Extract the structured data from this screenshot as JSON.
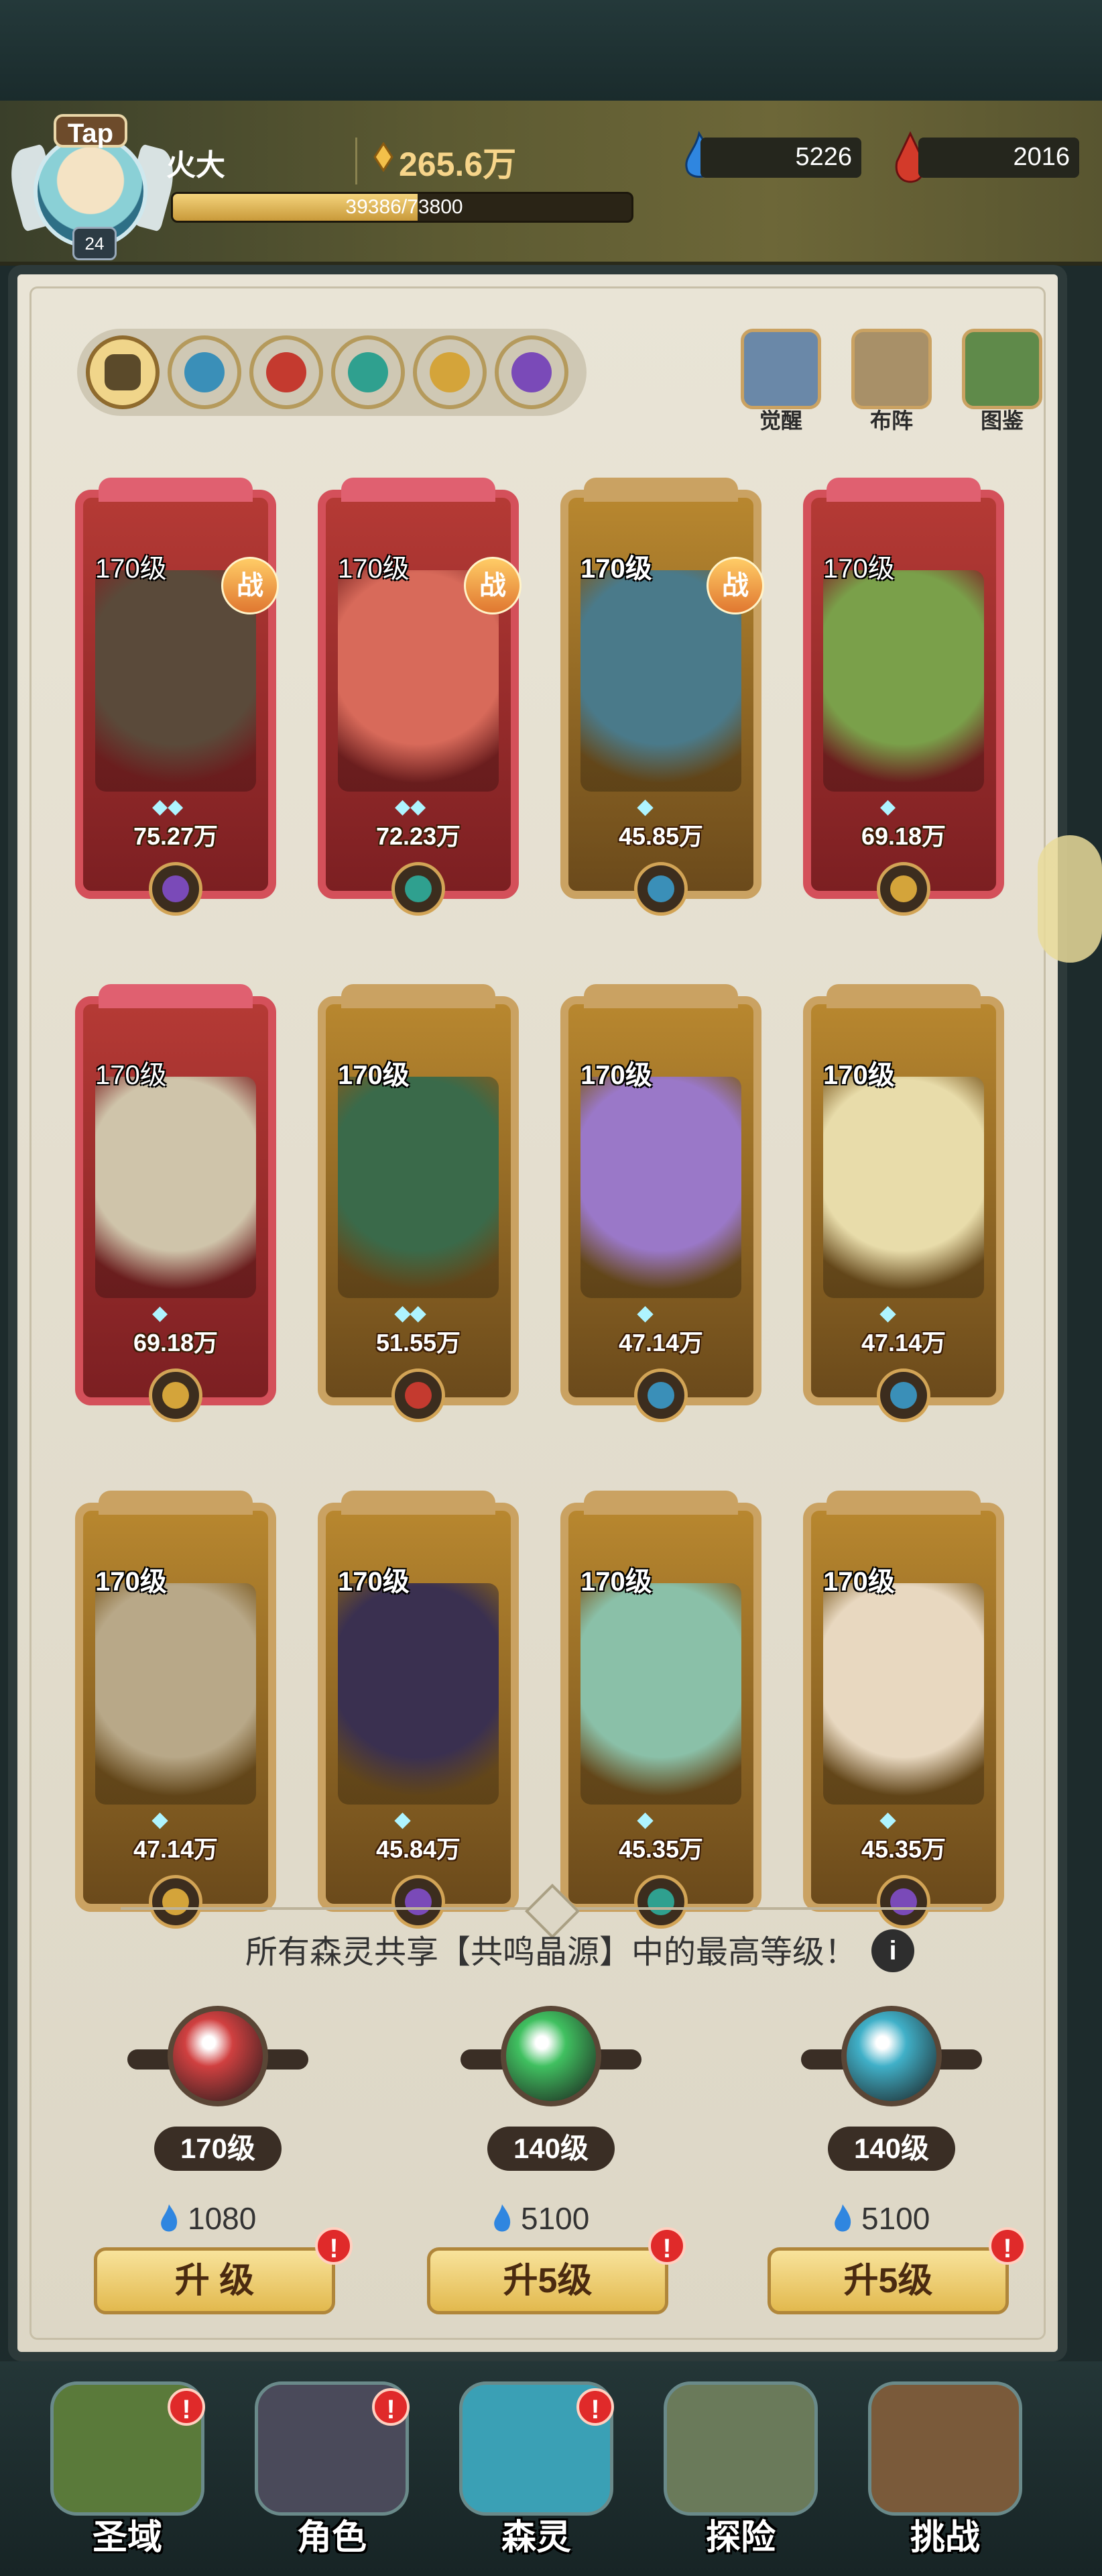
{
  "header": {
    "avatar_badge": "Tap",
    "player_level": "24",
    "player_name": "火大",
    "gold": "265.6万",
    "xp_text": "39386/73800",
    "xp_progress": 0.534,
    "mana": "5226",
    "gems": "2016"
  },
  "element_tabs": [
    {
      "name": "all",
      "color": "#5b4a2a"
    },
    {
      "name": "water",
      "color": "#3a8fb8"
    },
    {
      "name": "fire",
      "color": "#c43a2f"
    },
    {
      "name": "wind",
      "color": "#2fa08f"
    },
    {
      "name": "light",
      "color": "#d4a43a"
    },
    {
      "name": "dark",
      "color": "#7a4ab8"
    }
  ],
  "top_buttons": [
    {
      "label": "觉醒",
      "icon": "awaken-icon"
    },
    {
      "label": "布阵",
      "icon": "formation-icon"
    },
    {
      "label": "图鉴",
      "icon": "codex-icon"
    }
  ],
  "heroes": [
    {
      "level": "170级",
      "power": "75.27万",
      "stars": "◆◆",
      "in_battle": "战",
      "frame": "red",
      "element": "dark",
      "art": "#5a4a3a"
    },
    {
      "level": "170级",
      "power": "72.23万",
      "stars": "◆◆",
      "in_battle": "战",
      "frame": "red",
      "element": "wind",
      "art": "#d86a5a"
    },
    {
      "level": "170级",
      "power": "45.85万",
      "stars": "◆",
      "in_battle": "战",
      "frame": "gold",
      "element": "water",
      "art": "#4a7a8a"
    },
    {
      "level": "170级",
      "power": "69.18万",
      "stars": "◆",
      "in_battle": "",
      "frame": "red",
      "element": "light",
      "art": "#7aa04a"
    },
    {
      "level": "170级",
      "power": "69.18万",
      "stars": "◆",
      "in_battle": "",
      "frame": "red",
      "element": "light",
      "art": "#cfc4aa"
    },
    {
      "level": "170级",
      "power": "51.55万",
      "stars": "◆◆",
      "in_battle": "",
      "frame": "gold",
      "element": "fire",
      "art": "#3a6a4a"
    },
    {
      "level": "170级",
      "power": "47.14万",
      "stars": "◆",
      "in_battle": "",
      "frame": "gold",
      "element": "water",
      "art": "#9a78c8"
    },
    {
      "level": "170级",
      "power": "47.14万",
      "stars": "◆",
      "in_battle": "",
      "frame": "gold",
      "element": "water",
      "art": "#e8dcaa"
    },
    {
      "level": "170级",
      "power": "47.14万",
      "stars": "◆",
      "in_battle": "",
      "frame": "gold",
      "element": "light",
      "art": "#b8a888"
    },
    {
      "level": "170级",
      "power": "45.84万",
      "stars": "◆",
      "in_battle": "",
      "frame": "gold",
      "element": "dark",
      "art": "#3a3050"
    },
    {
      "level": "170级",
      "power": "45.35万",
      "stars": "◆",
      "in_battle": "",
      "frame": "gold",
      "element": "wind",
      "art": "#8ac0a8"
    },
    {
      "level": "170级",
      "power": "45.35万",
      "stars": "◆",
      "in_battle": "",
      "frame": "gold",
      "element": "dark",
      "art": "#e8d8c0"
    }
  ],
  "resonance": {
    "text": "所有森灵共享【共鸣晶源】中的最高等级！",
    "info_label": "i",
    "slots": [
      {
        "level": "170级",
        "cost": "1080",
        "button": "升 级",
        "orb_color": "#d04040",
        "alert": "!"
      },
      {
        "level": "140级",
        "cost": "5100",
        "button": "升5级",
        "orb_color": "#40c060",
        "alert": "!"
      },
      {
        "level": "140级",
        "cost": "5100",
        "button": "升5级",
        "orb_color": "#40b0c8",
        "alert": "!"
      }
    ]
  },
  "bottom_nav": [
    {
      "label": "圣域",
      "icon": "sanctuary-icon",
      "alert": "!",
      "active": false
    },
    {
      "label": "角色",
      "icon": "character-icon",
      "alert": "!",
      "active": false
    },
    {
      "label": "森灵",
      "icon": "forest-spirit-icon",
      "alert": "!",
      "active": true
    },
    {
      "label": "探险",
      "icon": "adventure-icon",
      "alert": "",
      "active": false
    },
    {
      "label": "挑战",
      "icon": "challenge-icon",
      "alert": "",
      "active": false
    }
  ]
}
